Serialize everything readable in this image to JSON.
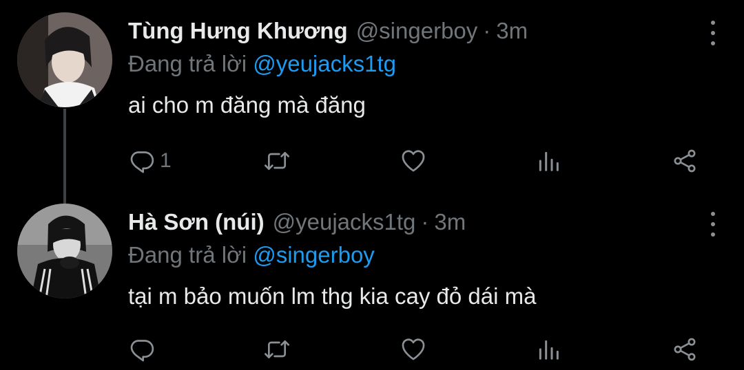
{
  "tweets": [
    {
      "display_name": "Tùng Hưng Khương",
      "handle": "@singerboy",
      "separator": "·",
      "time": "3m",
      "reply_prefix": "Đang trả lời",
      "reply_mention": "@yeujacks1tg",
      "text": "ai cho m đăng mà đăng",
      "reply_count": "1",
      "retweet_count": "",
      "like_count": ""
    },
    {
      "display_name": "Hà Sơn (núi)",
      "handle": "@yeujacks1tg",
      "separator": "·",
      "time": "3m",
      "reply_prefix": "Đang trả lời",
      "reply_mention": "@singerboy",
      "text": "tại m bảo muốn lm thg kia cay đỏ dái mà",
      "reply_count": "",
      "retweet_count": "",
      "like_count": ""
    }
  ],
  "icons": {
    "reply": "reply-icon",
    "retweet": "retweet-icon",
    "like": "heart-icon",
    "views": "views-icon",
    "share": "share-icon",
    "more": "more-vertical-icon"
  },
  "colors": {
    "background": "#000000",
    "primary_text": "#e7e9ea",
    "secondary_text": "#71767b",
    "accent": "#1d9bf0",
    "thread_line": "#3e4144"
  }
}
